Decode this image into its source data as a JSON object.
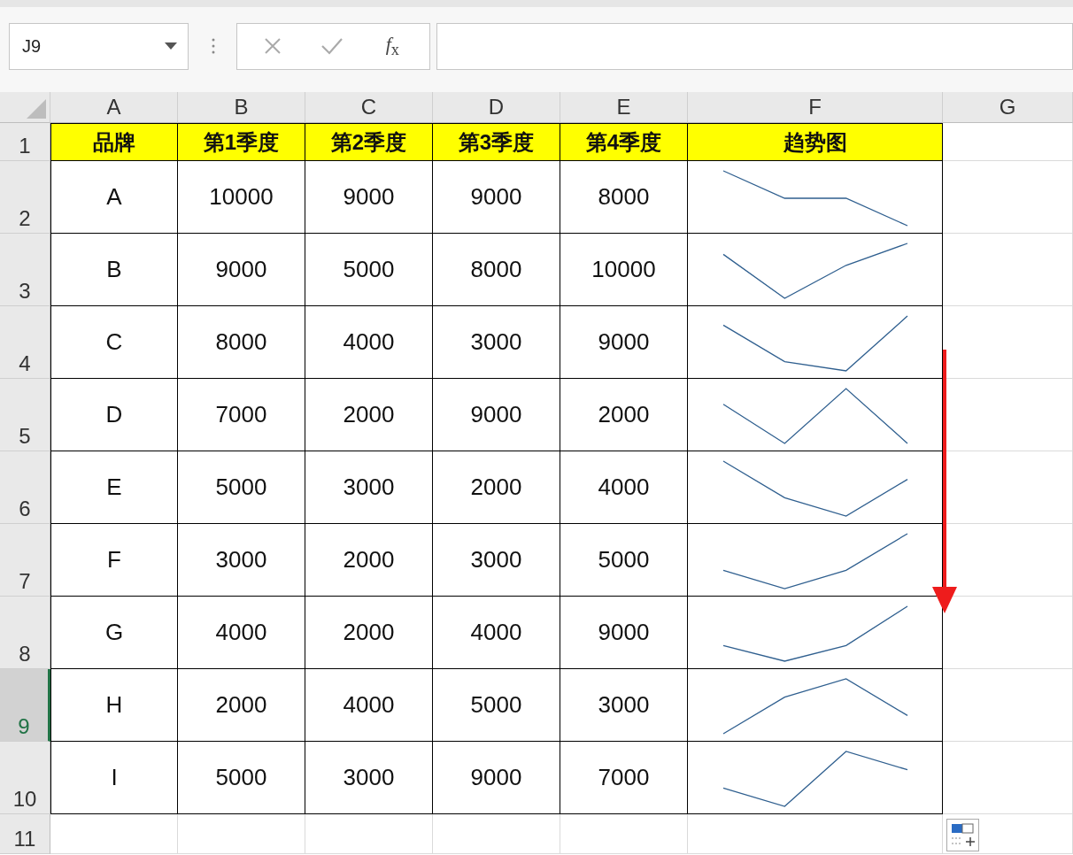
{
  "name_box": {
    "value": "J9"
  },
  "formula_bar": {
    "function_button": "*f*$_{x}$"
  },
  "columns": [
    {
      "label": "A"
    },
    {
      "label": "B"
    },
    {
      "label": "C"
    },
    {
      "label": "D"
    },
    {
      "label": "E"
    },
    {
      "label": "F"
    },
    {
      "label": "G"
    }
  ],
  "rows": [
    {
      "kind": "header",
      "row_number": "1",
      "selected": false,
      "cells": [
        "品牌",
        "第1季度",
        "第2季度",
        "第3季度",
        "第4季度",
        "趋势图"
      ]
    },
    {
      "kind": "data",
      "row_number": "2",
      "selected": false,
      "cells": [
        "A",
        "10000",
        "9000",
        "9000",
        "8000"
      ]
    },
    {
      "kind": "data",
      "row_number": "3",
      "selected": false,
      "cells": [
        "B",
        "9000",
        "5000",
        "8000",
        "10000"
      ]
    },
    {
      "kind": "data",
      "row_number": "4",
      "selected": false,
      "cells": [
        "C",
        "8000",
        "4000",
        "3000",
        "9000"
      ]
    },
    {
      "kind": "data",
      "row_number": "5",
      "selected": false,
      "cells": [
        "D",
        "7000",
        "2000",
        "9000",
        "2000"
      ]
    },
    {
      "kind": "data",
      "row_number": "6",
      "selected": false,
      "cells": [
        "E",
        "5000",
        "3000",
        "2000",
        "4000"
      ]
    },
    {
      "kind": "data",
      "row_number": "7",
      "selected": false,
      "cells": [
        "F",
        "3000",
        "2000",
        "3000",
        "5000"
      ]
    },
    {
      "kind": "data",
      "row_number": "8",
      "selected": false,
      "cells": [
        "G",
        "4000",
        "2000",
        "4000",
        "9000"
      ]
    },
    {
      "kind": "data",
      "row_number": "9",
      "selected": true,
      "cells": [
        "H",
        "2000",
        "4000",
        "5000",
        "3000"
      ]
    },
    {
      "kind": "data",
      "row_number": "10",
      "selected": false,
      "cells": [
        "I",
        "5000",
        "3000",
        "9000",
        "7000"
      ]
    },
    {
      "kind": "empty",
      "row_number": "11",
      "selected": false,
      "cells": []
    }
  ]
}
